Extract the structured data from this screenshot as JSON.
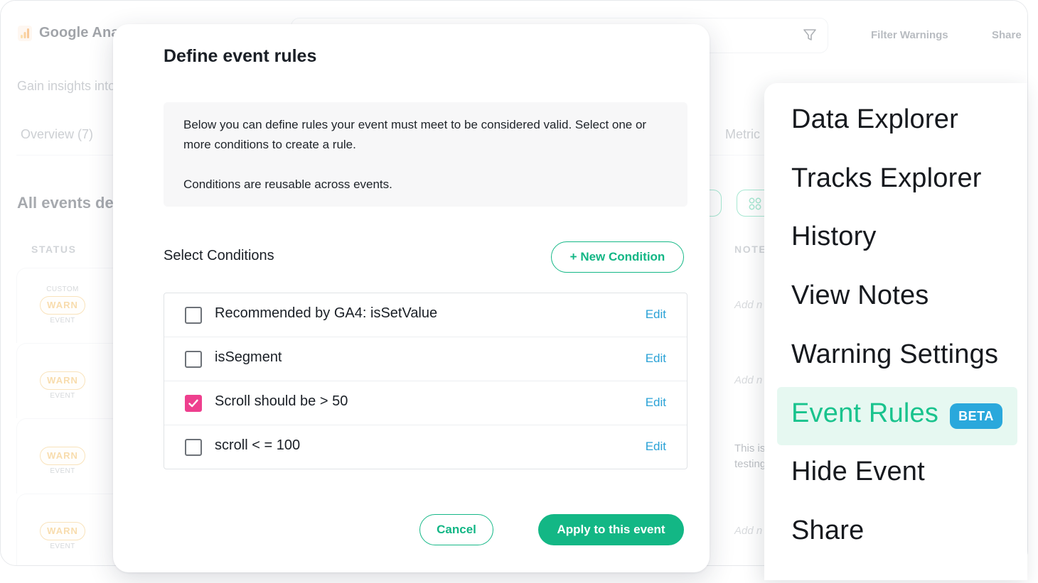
{
  "app": {
    "title": "Google Ana",
    "subtitle": "Gain insights into",
    "filter_warnings": "Filter Warnings",
    "share": "Share",
    "tabs": {
      "overview": "Overview (7)",
      "metrics": "Metric"
    },
    "section_title": "All events de",
    "columns": {
      "status": "STATUS",
      "notes": "NOTE"
    },
    "rows": [
      {
        "top_label": "CUSTOM",
        "badge": "WARN",
        "bottom_label": "EVENT",
        "note": "Add n"
      },
      {
        "top_label": "",
        "badge": "WARN",
        "bottom_label": "EVENT",
        "note": "Add n"
      },
      {
        "top_label": "",
        "badge": "WARN",
        "bottom_label": "EVENT",
        "note": "This is testing"
      },
      {
        "top_label": "",
        "badge": "WARN",
        "bottom_label": "EVENT",
        "note": "Add n"
      }
    ]
  },
  "modal": {
    "title": "Define event rules",
    "info_line1": "Below you can define rules your event must meet to be considered valid. Select one or more conditions to create a rule.",
    "info_line2": "Conditions are reusable across events.",
    "select_label": "Select Conditions",
    "new_condition": "+ New Condition",
    "conditions": [
      {
        "label": "Recommended by GA4: isSetValue",
        "checked": false,
        "edit": "Edit"
      },
      {
        "label": "isSegment",
        "checked": false,
        "edit": "Edit"
      },
      {
        "label": "Scroll should be > 50",
        "checked": true,
        "edit": "Edit"
      },
      {
        "label": "scroll < = 100",
        "checked": false,
        "edit": "Edit"
      }
    ],
    "cancel": "Cancel",
    "apply": "Apply to this event"
  },
  "menu": {
    "items": [
      {
        "label": "Data Explorer"
      },
      {
        "label": "Tracks Explorer"
      },
      {
        "label": "History"
      },
      {
        "label": "View Notes"
      },
      {
        "label": "Warning Settings"
      },
      {
        "label": "Event Rules",
        "badge": "BETA",
        "active": true
      },
      {
        "label": "Hide Event"
      },
      {
        "label": "Share"
      }
    ]
  },
  "colors": {
    "accent_green": "#13b785",
    "warn_orange": "#efb24a",
    "edit_blue": "#2aa2d6",
    "checkbox_pink": "#ee3f8e",
    "beta_blue": "#2aa8dc"
  }
}
